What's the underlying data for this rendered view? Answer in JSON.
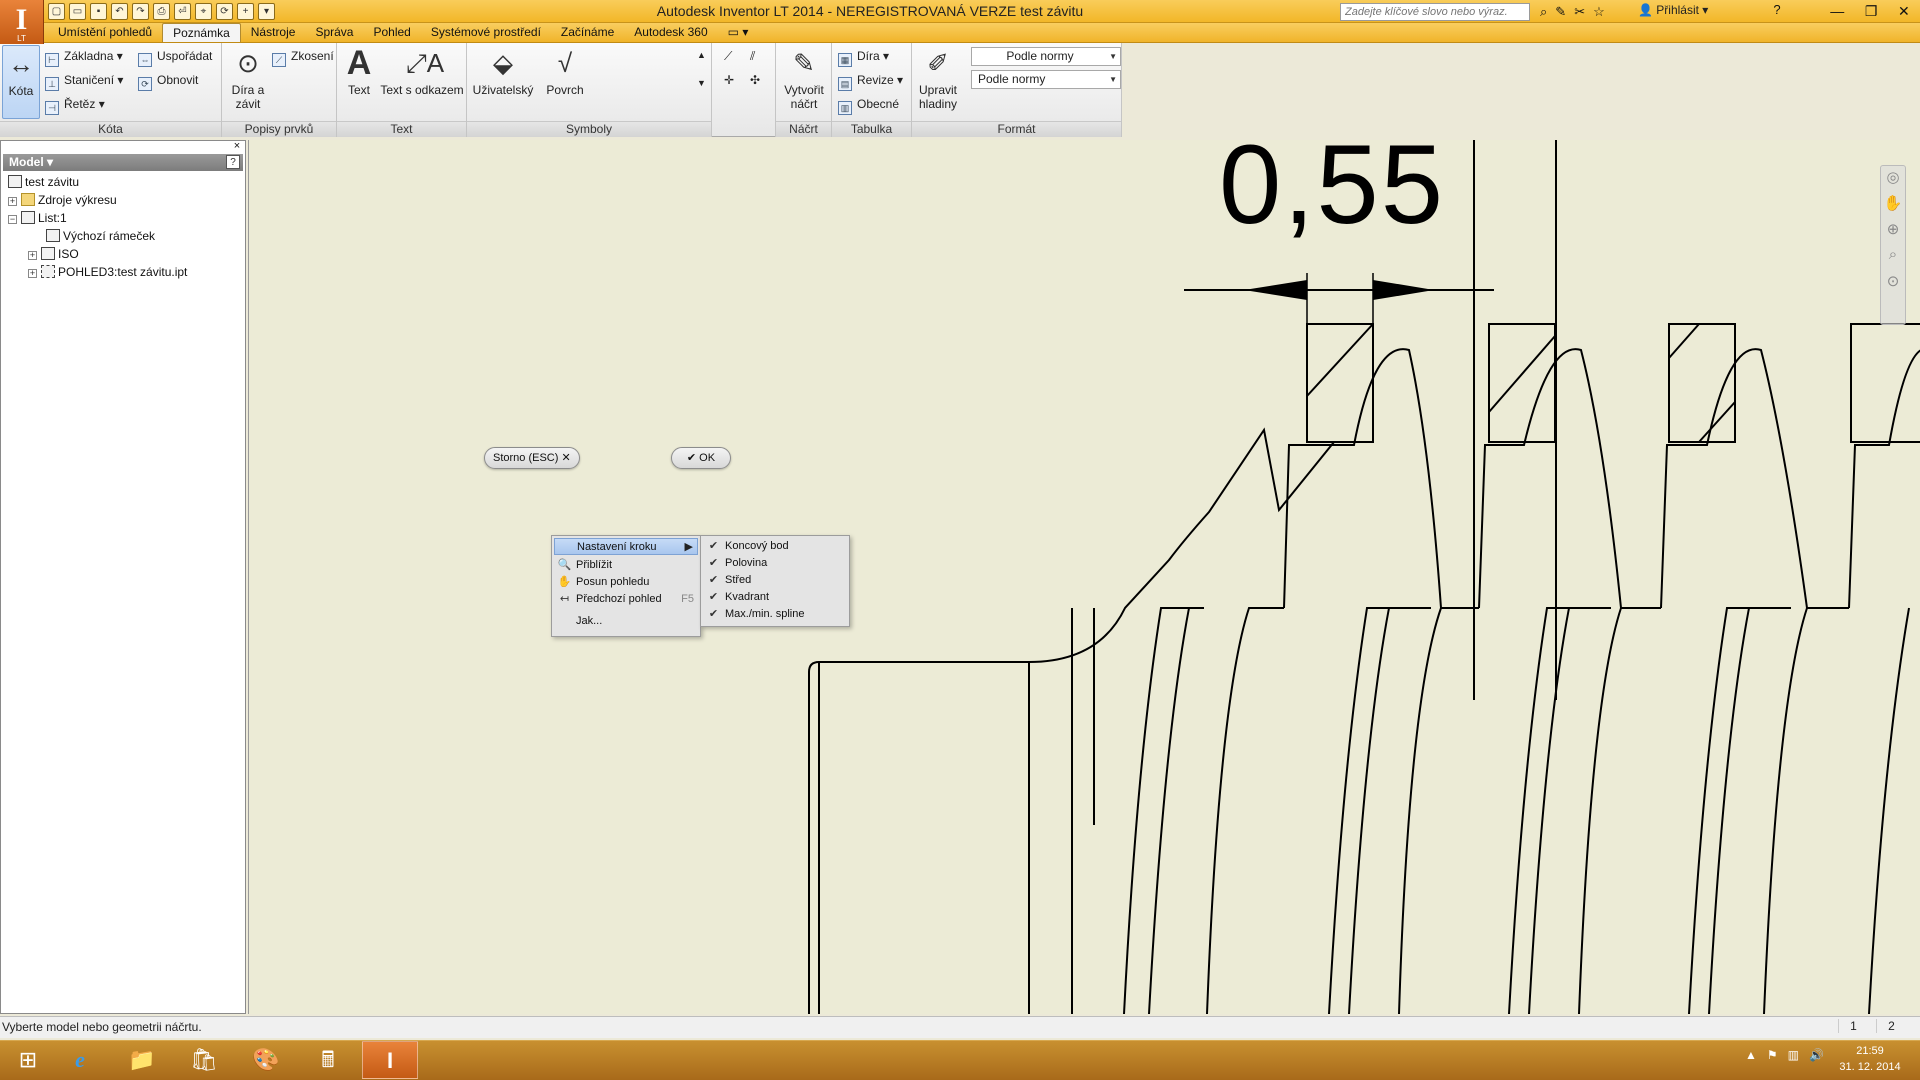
{
  "app": {
    "logo": "I",
    "logo_sub": "LT",
    "title": "Autodesk Inventor LT 2014 - NEREGISTROVANÁ VERZE    test závitu"
  },
  "search": {
    "placeholder": "Zadejte klíčové slovo nebo výraz."
  },
  "signin": "Přihlásit",
  "help": "?",
  "window_controls": [
    "—",
    "❐",
    "✕"
  ],
  "tabs": [
    {
      "label": "Umístění pohledů",
      "active": false
    },
    {
      "label": "Poznámka",
      "active": true
    },
    {
      "label": "Nástroje",
      "active": false
    },
    {
      "label": "Správa",
      "active": false
    },
    {
      "label": "Pohled",
      "active": false
    },
    {
      "label": "Systémové prostředí",
      "active": false
    },
    {
      "label": "Začínáme",
      "active": false
    },
    {
      "label": "Autodesk 360",
      "active": false
    }
  ],
  "ribbon": {
    "kota": {
      "title": "Kóta",
      "kota_btn": "Kóta",
      "zakladna": "Základna",
      "staniceni": "Staničení",
      "retez": "Řetěz",
      "usporadat": "Uspořádat",
      "obnovit": "Obnovit"
    },
    "popisy": {
      "title": "Popisy prvků",
      "dira_zavit_1": "Díra a",
      "dira_zavit_2": "závit",
      "zkoseni": "Zkosení"
    },
    "text": {
      "title": "Text",
      "text_btn": "Text",
      "text_odkaz": "Text s odkazem"
    },
    "symboly": {
      "title": "Symboly",
      "uzivatelsky": "Uživatelský",
      "povrch": "Povrch"
    },
    "nacrt": {
      "title": "Náčrt",
      "vytvorit_1": "Vytvořit",
      "vytvorit_2": "náčrt"
    },
    "tabulka": {
      "title": "Tabulka",
      "dira": "Díra",
      "revize": "Revize",
      "obecne": "Obecné"
    },
    "format": {
      "title": "Formát",
      "upravit_1": "Upravit",
      "upravit_2": "hladiny",
      "style1": "Podle normy",
      "style2": "Podle normy"
    }
  },
  "browser": {
    "title": "Model ▾",
    "help": "?",
    "close": "×",
    "tree": [
      {
        "label": "test závitu",
        "exp": ""
      },
      {
        "label": "Zdroje výkresu",
        "exp": "+"
      },
      {
        "label": "List:1",
        "exp": "−"
      },
      {
        "label": "Výchozí rámeček",
        "exp": ""
      },
      {
        "label": "ISO",
        "exp": "+"
      },
      {
        "label": "POHLED3:test závitu.ipt",
        "exp": "+"
      }
    ]
  },
  "drawing": {
    "dimension": "0,55"
  },
  "canvas_buttons": {
    "cancel": "Storno (ESC)  ✕",
    "ok": "✔  OK"
  },
  "context_menu": {
    "items": [
      {
        "label": "Nastavení kroku",
        "icon": "",
        "accel": "▶"
      },
      {
        "label": "Přiblížit",
        "icon": "🔍",
        "accel": ""
      },
      {
        "label": "Posun pohledu",
        "icon": "✋",
        "accel": ""
      },
      {
        "label": "Předchozí pohled",
        "icon": "↤",
        "accel": "F5"
      },
      {
        "label": "Jak...",
        "icon": "",
        "accel": ""
      }
    ]
  },
  "submenu": {
    "items": [
      {
        "label": "Koncový bod",
        "checked": true
      },
      {
        "label": "Polovina",
        "checked": true
      },
      {
        "label": "Střed",
        "checked": true
      },
      {
        "label": "Kvadrant",
        "checked": true
      },
      {
        "label": "Max./min. spline",
        "checked": true
      }
    ]
  },
  "status": {
    "text": "Vyberte model nebo geometrii náčrtu.",
    "num1": "1",
    "num2": "2"
  },
  "taskbar": {
    "apps": [
      "⊞",
      "e",
      "📁",
      "🛍",
      "🎨",
      "🖩",
      "I"
    ],
    "time": "21:59",
    "date": "31. 12. 2014"
  },
  "colors": {
    "accent": "#f2b728",
    "canvas": "#ecebd6",
    "highlight": "#a8c6ee"
  }
}
